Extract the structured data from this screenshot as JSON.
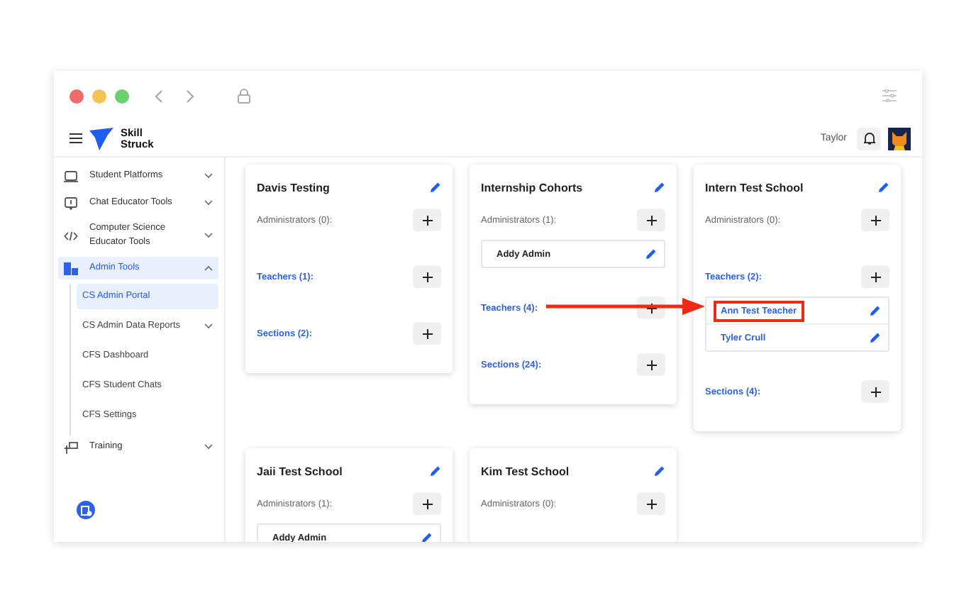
{
  "header": {
    "logo_lines": [
      "Skill",
      "Struck"
    ],
    "user_name": "Taylor"
  },
  "sidebar": {
    "items": [
      {
        "label": "Student Platforms",
        "expanded": false,
        "selected": false
      },
      {
        "label": "Chat Educator Tools",
        "expanded": false,
        "selected": false
      },
      {
        "label": "Computer Science Educator Tools",
        "expanded": false,
        "selected": false
      },
      {
        "label": "Admin Tools",
        "expanded": true,
        "selected": true,
        "children": [
          {
            "label": "CS Admin Portal",
            "kind": "link",
            "selected": true
          },
          {
            "label": "CS Admin Data Reports",
            "kind": "group",
            "selected": false,
            "expanded": false
          },
          {
            "label": "CFS Dashboard",
            "kind": "link",
            "selected": false
          },
          {
            "label": "CFS Student Chats",
            "kind": "link",
            "selected": false
          },
          {
            "label": "CFS Settings",
            "kind": "link",
            "selected": false
          }
        ]
      },
      {
        "label": "Training",
        "expanded": false,
        "selected": false
      }
    ]
  },
  "schools": [
    {
      "title": "Davis Testing",
      "sections": [
        {
          "kind": "admins",
          "label": "Administrators (0):"
        },
        {
          "kind": "teachers",
          "label": "Teachers (1):"
        },
        {
          "kind": "sections",
          "label": "Sections (2):"
        }
      ]
    },
    {
      "title": "Internship Cohorts",
      "sections": [
        {
          "kind": "admins",
          "label": "Administrators (1):",
          "people": [
            {
              "name": "Addy Admin",
              "highlighted": false
            }
          ]
        },
        {
          "kind": "teachers",
          "label": "Teachers (4):"
        },
        {
          "kind": "sections",
          "label": "Sections (24):"
        }
      ]
    },
    {
      "title": "Intern Test School",
      "sections": [
        {
          "kind": "admins",
          "label": "Administrators (0):"
        },
        {
          "kind": "teachers",
          "label": "Teachers (2):",
          "people": [
            {
              "name": "Ann Test Teacher",
              "highlighted": true
            },
            {
              "name": "Tyler Crull",
              "highlighted": false
            }
          ]
        },
        {
          "kind": "sections",
          "label": "Sections (4):"
        }
      ]
    },
    {
      "title": "Jaii Test School",
      "sections": [
        {
          "kind": "admins",
          "label": "Administrators (1):",
          "people": [
            {
              "name": "Addy Admin",
              "highlighted": false
            }
          ]
        }
      ]
    },
    {
      "title": "Kim Test School",
      "sections": [
        {
          "kind": "admins",
          "label": "Administrators (0):"
        }
      ]
    }
  ]
}
